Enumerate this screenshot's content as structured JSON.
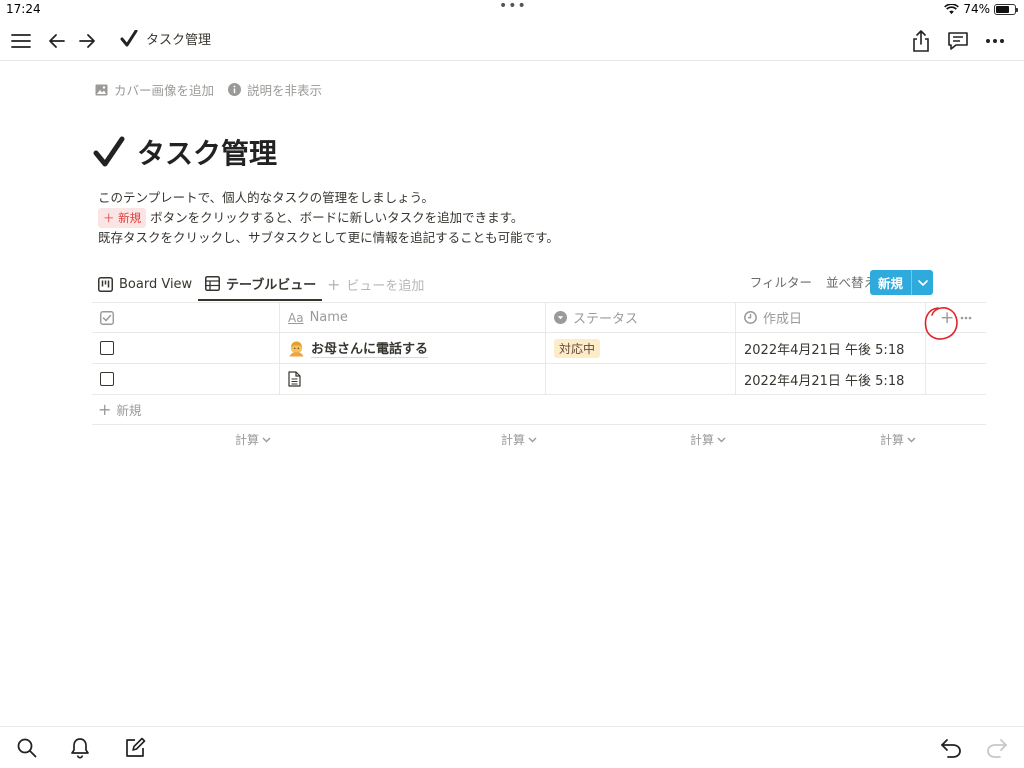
{
  "statusbar": {
    "time": "17:24",
    "battery": "74%",
    "battery_level": 0.74
  },
  "nav": {
    "page_title": "タスク管理",
    "icons": [
      "menu-icon",
      "back-arrow-icon",
      "forward-arrow-icon",
      "checkmark-icon",
      "share-icon",
      "comment-icon",
      "more-icon"
    ]
  },
  "page": {
    "actions": {
      "add_cover": "カバー画像を追加",
      "hide_description": "説明を非表示"
    },
    "title": "タスク管理",
    "description": {
      "line1": "このテンプレートで、個人的なタスクの管理をしましょう。",
      "line2_pill": "＋ 新規",
      "line2": "ボタンをクリックすると、ボードに新しいタスクを追加できます。",
      "line3": "既存タスクをクリックし、サブタスクとして更に情報を追記することも可能です。"
    }
  },
  "views": {
    "board": "Board View",
    "table": "テーブルビュー",
    "add_view": "ビューを追加",
    "filter": "フィルター",
    "sort": "並べ替え",
    "new_button": "新規"
  },
  "table": {
    "headers": {
      "name": "Name",
      "status": "ステータス",
      "created": "作成日"
    },
    "rows": [
      {
        "name": "お母さんに電話する",
        "status": "対応中",
        "created": "2022年4月21日 午後 5:18"
      },
      {
        "name": "",
        "status": "",
        "created": "2022年4月21日 午後 5:18"
      }
    ],
    "add_row": "新規",
    "calc": "計算"
  },
  "colors": {
    "accent": "#2eaadc",
    "status_bg": "#fdecc8",
    "annotation": "#e0252a"
  }
}
